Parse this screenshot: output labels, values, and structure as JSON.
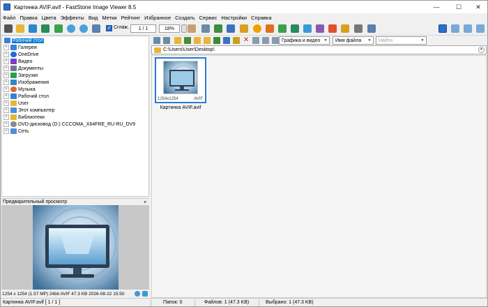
{
  "window": {
    "title": "Картинка AVIF.avif - FastStone Image Viewer 8.5",
    "minimize_glyph": "—",
    "maximize_glyph": "☐",
    "close_glyph": "✕"
  },
  "menu": [
    "Файл",
    "Правка",
    "Цвета",
    "Эффекты",
    "Вид",
    "Метки",
    "Рейтинг",
    "Избранное",
    "Создать",
    "Сервис",
    "Настройки",
    "Справка"
  ],
  "toolbar": {
    "smooth_label": "Сглаж.",
    "page_counter": "1 / 1",
    "zoom_value": "18%"
  },
  "tree": {
    "items": [
      {
        "label": "Рабочий стол",
        "icon": "desktop-icon",
        "color": "#3a7fd5"
      },
      {
        "label": "Галерея",
        "icon": "gallery-icon",
        "color": "#3a7fd5"
      },
      {
        "label": "OneDrive",
        "icon": "cloud-icon",
        "color": "#1a6fd8"
      },
      {
        "label": "Видео",
        "icon": "video-folder-icon",
        "color": "#7a3fbf"
      },
      {
        "label": "Документы",
        "icon": "documents-icon",
        "color": "#6b7a8f"
      },
      {
        "label": "Загрузки",
        "icon": "downloads-icon",
        "color": "#2f9b4c"
      },
      {
        "label": "Изображения",
        "icon": "pictures-icon",
        "color": "#2f86c9"
      },
      {
        "label": "Музыка",
        "icon": "music-icon",
        "color": "#e06a2a"
      },
      {
        "label": "Рабочий стол",
        "icon": "desktop-icon",
        "color": "#3a7fd5"
      },
      {
        "label": "User",
        "icon": "user-folder-icon",
        "color": "#e7b53a"
      },
      {
        "label": "Этот компьютер",
        "icon": "computer-icon",
        "color": "#4a90d9"
      },
      {
        "label": "Библиотеки",
        "icon": "libraries-icon",
        "color": "#e7b53a"
      },
      {
        "label": "DVD-дисковод (D:) CCCOMA_X64FRE_RU-RU_DV9",
        "icon": "dvd-icon",
        "color": "#8a8a8a"
      },
      {
        "label": "Сеть",
        "icon": "network-icon",
        "color": "#4a90d9"
      }
    ]
  },
  "preview": {
    "header": "Предварительный просмотр",
    "pin_glyph": "⌅",
    "info": "1254 x 1254 (1.57 MP)  24bit  AVIF   47.3 KB   2026-08-22 15:50"
  },
  "browser": {
    "filter_select": "Графика и видео",
    "sort_select": "Имя файла",
    "search_placeholder": "Найти",
    "path": "C:\\Users\\User\\Desktop\\",
    "thumbnail": {
      "name": "Картинка AVIF.avif",
      "dimensions": "1254x1254",
      "format": "AVIF"
    }
  },
  "status": {
    "file_info": "Картинка AVIF.avif [ 1 / 1 ]",
    "folders": "Папок: 0",
    "files": "Файлов: 1 (47.3 KB)",
    "selected": "Выбрано: 1 (47.3 KB)"
  },
  "colors": {
    "accent": "#0078d7",
    "thumb_border": "#2b79d6",
    "folder": "#e7b53a"
  }
}
